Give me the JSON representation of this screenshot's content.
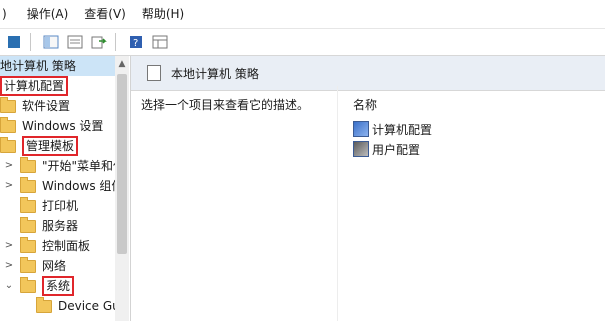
{
  "menu": [
    ")",
    "操作(A)",
    "查看(V)",
    "帮助(H)"
  ],
  "toolbar": {
    "icons": [
      "back-icon",
      "forward-icon",
      "show-hide-tree-icon",
      "properties-icon",
      "export-icon",
      "help-icon",
      "view-icon"
    ]
  },
  "tree": {
    "root_label": "地计算机 策略",
    "items": [
      {
        "label": "计算机配置",
        "expander": "",
        "highlighted": true,
        "selected": true
      },
      {
        "label": "软件设置",
        "expander": "",
        "highlighted": false
      },
      {
        "label": "Windows 设置",
        "expander": "",
        "highlighted": false
      },
      {
        "label": "管理模板",
        "expander": "",
        "highlighted": true
      },
      {
        "label": "\"开始\"菜单和任",
        "expander": ">",
        "highlighted": false
      },
      {
        "label": "Windows 组件",
        "expander": ">",
        "highlighted": false
      },
      {
        "label": "打印机",
        "expander": "",
        "highlighted": false
      },
      {
        "label": "服务器",
        "expander": "",
        "highlighted": false
      },
      {
        "label": "控制面板",
        "expander": ">",
        "highlighted": false
      },
      {
        "label": "网络",
        "expander": ">",
        "highlighted": false
      },
      {
        "label": "系统",
        "expander": "⌄",
        "highlighted": true
      },
      {
        "label": "Device Gu",
        "expander": "",
        "highlighted": false
      }
    ]
  },
  "content": {
    "header_title": "本地计算机 策略",
    "description": "选择一个项目来查看它的描述。",
    "column_name": "名称",
    "rows": [
      {
        "label": "计算机配置",
        "icon": "computer-config-icon"
      },
      {
        "label": "用户配置",
        "icon": "user-config-icon"
      }
    ]
  },
  "colors": {
    "highlight_box": "#e0262b",
    "selection": "#cce4f7",
    "header_bg": "#e9eef5"
  }
}
